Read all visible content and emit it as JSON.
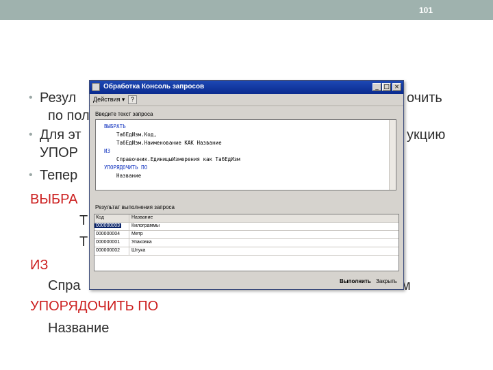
{
  "slide": {
    "page_number": "101",
    "bullets": [
      {
        "left": "Резул",
        "right": "очить"
      },
      {
        "left": "по пол",
        "right": ""
      },
      {
        "left": "Для эт",
        "right": "укцию"
      },
      {
        "left": "УПОР",
        "right": ""
      },
      {
        "left": "Тепер",
        "right": ""
      }
    ],
    "code_lines": {
      "select_kw": "ВЫБРА",
      "t1": "Т",
      "t2": "Т",
      "from_kw": "ИЗ",
      "from_src_left": "Спра",
      "from_src_right": "м",
      "order_kw": "УПОРЯДОЧИТЬ ПО",
      "order_field": "Название"
    }
  },
  "window": {
    "title": "Обработка  Консоль запросов",
    "controls": [
      "_",
      "□",
      "×"
    ],
    "menu_actions": "Действия ▾",
    "help": "?",
    "query_label": "Введите текст запроса",
    "query": [
      {
        "kw": "ВЫБРАТЬ",
        "rest": ""
      },
      {
        "kw": "",
        "rest": "    ТабЕдИзм.Код,"
      },
      {
        "kw": "",
        "rest": "    ТабЕдИзм.Наименование КАК Название"
      },
      {
        "kw": "ИЗ",
        "rest": ""
      },
      {
        "kw": "",
        "rest": "    Справочник.ЕдиницыИзмерения как ТабЕдИзм"
      },
      {
        "kw": "УПОРЯДОЧИТЬ ПО",
        "rest": ""
      },
      {
        "kw": "",
        "rest": "    Название"
      }
    ],
    "result_label": "Результат выполнения запроса",
    "columns": [
      "Код",
      "Название"
    ],
    "rows": [
      [
        "000000003",
        "Килограммы"
      ],
      [
        "000000004",
        "Метр"
      ],
      [
        "000000001",
        "Упаковка"
      ],
      [
        "000000002",
        "Штука"
      ]
    ],
    "run_button": "Выполнить",
    "close_button": "Закрыть"
  }
}
